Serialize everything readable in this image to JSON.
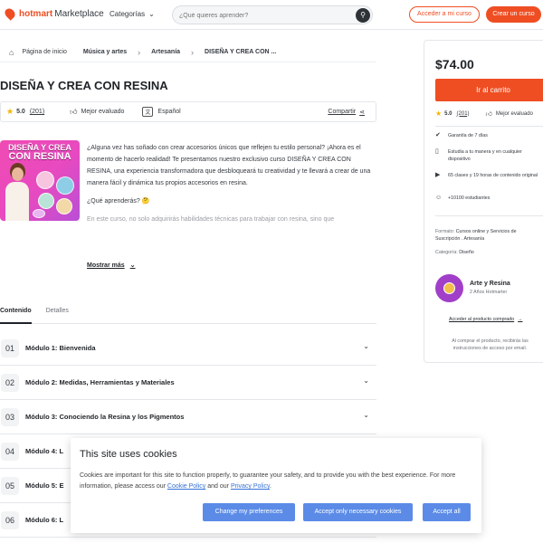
{
  "header": {
    "brand": "hotmart",
    "brand_suffix": "Marketplace",
    "categories_label": "Categorías",
    "search_placeholder": "¿Qué quieres aprender?",
    "access_button": "Acceder a mi curso",
    "create_button": "Crear un curso"
  },
  "breadcrumb": {
    "home": "Página de inicio",
    "items": [
      "Música y artes",
      "Artesanía",
      "DISEÑA Y CREA CON ..."
    ]
  },
  "course": {
    "title": "DISEÑA Y CREA CON RESINA",
    "rating": "5.0",
    "rating_count": "(201)",
    "badge": "Mejor evaluado",
    "language": "Español",
    "share": "Compartir",
    "thumbnail_line1": "DISEÑA Y CREA",
    "thumbnail_line2": "CON RESINA",
    "desc_p1": "¿Alguna vez has soñado con crear accesorios únicos que reflejen tu estilo personal? ¡Ahora es el momento de hacerlo realidad! Te presentamos nuestro exclusivo curso DISEÑA Y CREA CON RESINA, una experiencia transformadora que desbloqueará tu creatividad y te llevará a crear de una manera fácil y dinámica tus propios accesorios en resina.",
    "desc_q": "¿Qué aprenderás? 🤔",
    "desc_p2": "En este curso, no solo adquirirás habilidades técnicas para trabajar con resina, sino que",
    "show_more": "Mostrar más"
  },
  "tabs": [
    "Contenido",
    "Detalles"
  ],
  "modules": [
    {
      "num": "01",
      "title": "Módulo 1: Bienvenida"
    },
    {
      "num": "02",
      "title": "Módulo 2: Medidas, Herramientas y Materiales"
    },
    {
      "num": "03",
      "title": "Módulo 3: Conociendo la Resina y los Pigmentos"
    },
    {
      "num": "04",
      "title": "Módulo 4: L"
    },
    {
      "num": "05",
      "title": "Módulo 5: E"
    },
    {
      "num": "06",
      "title": "Módulo 6: L"
    }
  ],
  "sidebar": {
    "price": "$74.00",
    "cart_button": "Ir al carrito",
    "rating": "5.0",
    "rating_count": "(201)",
    "badge": "Mejor evaluado",
    "features": [
      {
        "icon": "check-icon",
        "text": "Garantía de 7 días"
      },
      {
        "icon": "phone-icon",
        "text": "Estudia a tu manera y en cualquier dispositivo"
      },
      {
        "icon": "play-icon",
        "text": "65 clases y 19 horas de contenido original"
      },
      {
        "icon": "user-icon",
        "text": "+10100 estudiantes"
      }
    ],
    "format_label": "Formato:",
    "format_value": "Cursos online y Servicios de Suscripción . Artesanía",
    "category_label": "Categoría:",
    "category_value": "Diseño",
    "author_name": "Arte y Resina",
    "author_years": "2 Años Hotmarter",
    "access_link": "Acceder al producto comprado",
    "note": "Al comprar el producto, recibirás las instrucciones de acceso por email."
  },
  "cookie": {
    "title": "This site uses cookies",
    "body_prefix": "Cookies are important for this site to function properly, to guarantee your safety, and to provide you with the best experience. For more information, please access our ",
    "policy_link": "Cookie Policy",
    "and": " and our ",
    "privacy_link": "Privacy Policy",
    "end": ".",
    "btn_change": "Change my preferences",
    "btn_necessary": "Accept only necessary cookies",
    "btn_all": "Accept all"
  },
  "colors": {
    "brand": "#ef4e23",
    "star": "#f5b400",
    "cookie_button": "#5b8be6"
  }
}
